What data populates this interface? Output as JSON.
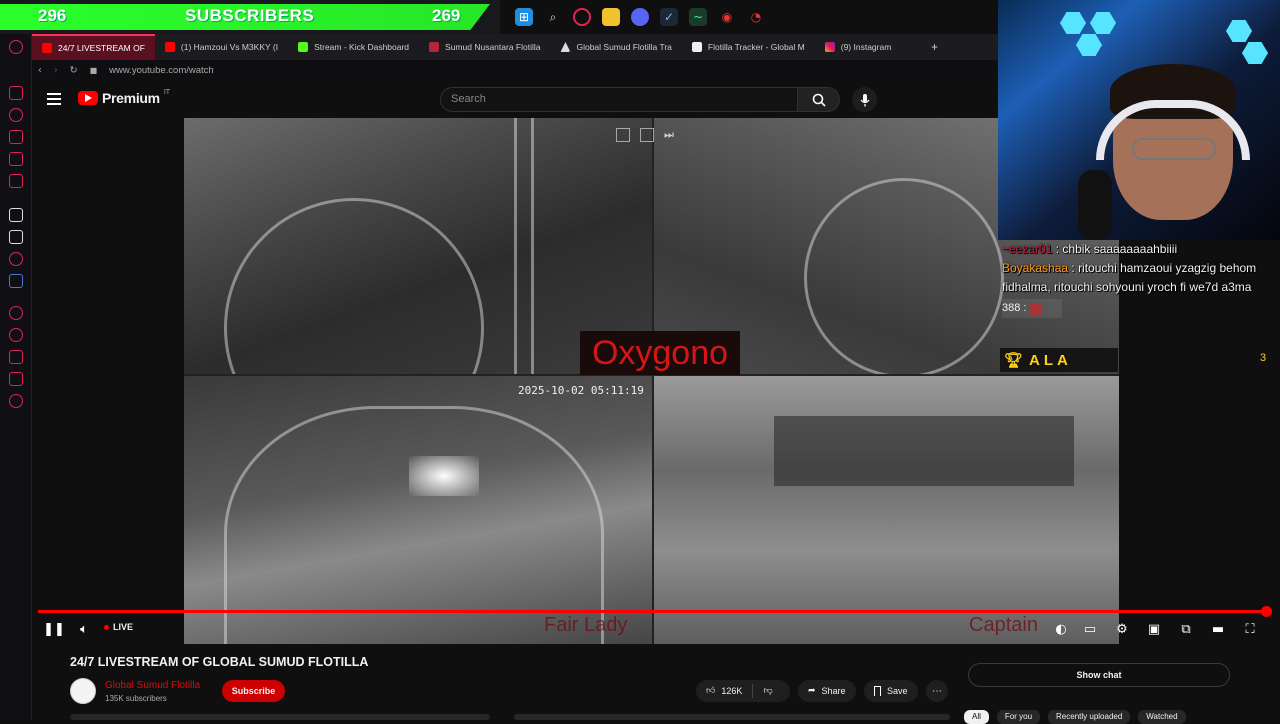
{
  "overlay": {
    "subscriber_count": "296",
    "subscribers_label": "SUBSCRIBERS",
    "goal_count": "269"
  },
  "taskbar_icons": [
    "windows-icon",
    "search-icon",
    "opera-icon",
    "folder-icon",
    "discord-icon",
    "steam-icon",
    "app-icon",
    "maps-pin-icon",
    "notification-icon"
  ],
  "tabs": [
    {
      "label": "24/7 LIVESTREAM OF",
      "active": true
    },
    {
      "label": "(1) Hamzoui Vs M3KKY (I",
      "active": false
    },
    {
      "label": "Stream - Kick Dashboard",
      "active": false
    },
    {
      "label": "Sumud Nusantara Flotilla",
      "active": false
    },
    {
      "label": "Global Sumud Flotilla Tra",
      "active": false
    },
    {
      "label": "Flotilla Tracker - Global M",
      "active": false
    },
    {
      "label": "(9) Instagram",
      "active": false
    }
  ],
  "address": {
    "url": "www.youtube.com/watch"
  },
  "youtube": {
    "logo_text": "Premium",
    "logo_region": "IT",
    "search_placeholder": "Search"
  },
  "video": {
    "timestamp_bottom_left": "2025-10-02 05:11:19",
    "timestamp_top": "2025-10-02 05:11:19",
    "overlay_title": "Oxygono",
    "cam_label_left": "Fair Lady",
    "cam_label_right": "Captain"
  },
  "player": {
    "live_label": "LIVE",
    "progress": 1.0
  },
  "chat": {
    "messages": [
      {
        "user": "~eezar01",
        "text": "chbik saaaaaaaahbiiii"
      },
      {
        "user": "Boyakashaa",
        "text": "ritouchi hamzaoui yzagzig behom fidhalma, ritouchi sohyouni yroch fi we7d a3ma"
      }
    ],
    "small_count": "388 :",
    "winner_name": "ALA",
    "side_count": "3"
  },
  "video_meta": {
    "title": "24/7 LIVESTREAM OF GLOBAL SUMUD FLOTILLA",
    "channel": "Global Sumud Flotilla",
    "subscribers": "135K subscribers",
    "subscribe_label": "Subscribe",
    "likes": "126K",
    "share_label": "Share",
    "save_label": "Save",
    "show_chat_label": "Show chat"
  },
  "chips": [
    "All",
    "For you",
    "Recently uploaded",
    "Watched"
  ],
  "colors": {
    "accent": "#ff0000",
    "overlay_green": "#2bff2b",
    "browser_accent": "#ff2d55"
  }
}
